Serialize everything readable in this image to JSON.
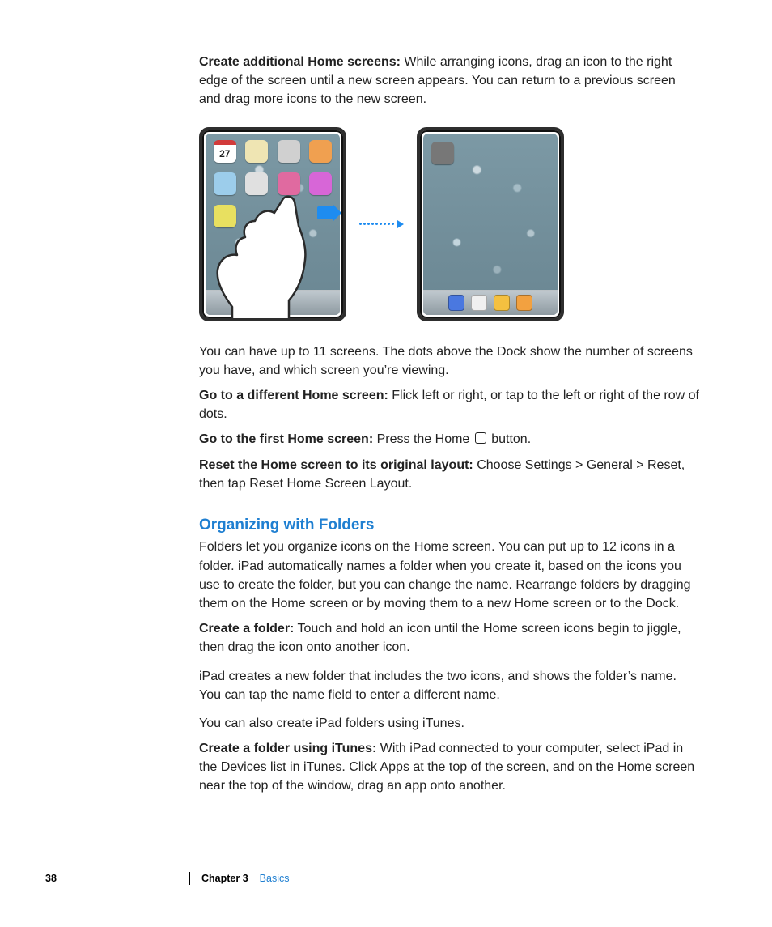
{
  "top": {
    "p1_bold": "Create additional Home screens:",
    "p1_rest": "  While arranging icons, drag an icon to the right edge of the screen until a new screen appears. You can return to a previous screen and drag more icons to the new screen."
  },
  "figure": {
    "left_icons": [
      {
        "bg": "#fdfdfd"
      },
      {
        "bg": "#efe5b3"
      },
      {
        "bg": "#d0d0d0"
      },
      {
        "bg": "#f0a050"
      },
      {
        "bg": "#9ccdeb"
      },
      {
        "bg": "#e0e0e0"
      },
      {
        "bg": "#e06aa0"
      },
      {
        "bg": "#d766d7"
      },
      {
        "bg": "#e8e060"
      }
    ],
    "left_dock": [
      {
        "bg": "#f2a140"
      }
    ],
    "right_dock": [
      {
        "bg": "#4a78e0"
      },
      {
        "bg": "#f0f0f0"
      },
      {
        "bg": "#f4c040"
      },
      {
        "bg": "#f2a140"
      }
    ],
    "calendar_day": "27"
  },
  "mid": {
    "after_fig": "You can have up to 11 screens. The dots above the Dock show the number of screens you have, and which screen you’re viewing.",
    "p2_bold": "Go to a different Home screen:",
    "p2_rest": "  Flick left or right, or tap to the left or right of the row of dots.",
    "p3_bold": "Go to the first Home screen:",
    "p3_rest_a": "  Press the Home ",
    "p3_rest_b": " button.",
    "p4_bold": "Reset the Home screen to its original layout:",
    "p4_rest": "  Choose Settings > General > Reset, then tap Reset Home Screen Layout."
  },
  "section_heading": "Organizing with Folders",
  "folders": {
    "intro": "Folders let you organize icons on the Home screen. You can put up to 12 icons in a folder. iPad automatically names a folder when you create it, based on the icons you use to create the folder, but you can change the name. Rearrange folders by dragging them on the Home screen or by moving them to a new Home screen or to the Dock.",
    "cf_bold": "Create a folder:",
    "cf_rest": "  Touch and hold an icon until the Home screen icons begin to jiggle, then drag the icon onto another icon.",
    "p_after1": "iPad creates a new folder that includes the two icons, and shows the folder’s name. You can tap the name field to enter a different name.",
    "p_after2": "You can also create iPad folders using iTunes.",
    "cfi_bold": "Create a folder using iTunes:",
    "cfi_rest": "  With iPad connected to your computer, select iPad in the Devices list in iTunes. Click Apps at the top of the screen, and on the Home screen near the top of the window, drag an app onto another."
  },
  "footer": {
    "page": "38",
    "chapter": "Chapter 3",
    "title": "Basics"
  }
}
